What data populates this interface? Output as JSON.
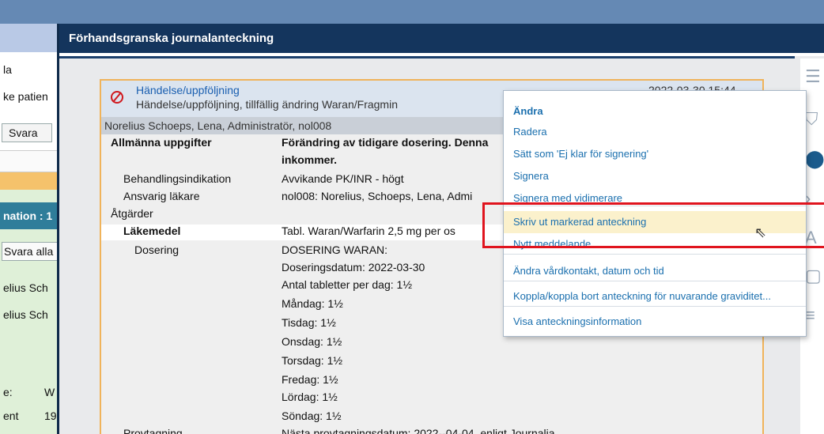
{
  "background": {
    "lines": [
      "la",
      "ke patien"
    ],
    "svara_button": "Svara",
    "info_bar": "nation : 1",
    "svara_alla_button": "Svara alla",
    "list_names": [
      "elius Sch",
      "elius Sch"
    ],
    "field_rows": [
      {
        "label": "e:",
        "value": "W"
      },
      {
        "label": "ent",
        "value": "19"
      }
    ]
  },
  "dialog": {
    "title": "Förhandsgranska journalanteckning"
  },
  "note": {
    "title": "Händelse/uppföljning",
    "subtitle": "Händelse/uppföljning, tillfällig ändring Waran/Fragmin",
    "datetime": "2022-03-30 15:44",
    "author": "Norelius Schoeps, Lena, Administratör, nol008",
    "rows": [
      {
        "label": "Allmänna uppgifter",
        "value": "Förändring av tidigare dosering. Denna",
        "bold": true
      },
      {
        "label": "",
        "value": "inkommer.",
        "bold": true
      },
      {
        "label": "Behandlingsindikation",
        "value": "Avvikande PK/INR - högt"
      },
      {
        "label": "Ansvarig läkare",
        "value": "nol008: Norelius, Schoeps, Lena, Admi"
      },
      {
        "label": "Åtgärder",
        "value": ""
      },
      {
        "label": "Läkemedel",
        "value": "Tabl. Waran/Warfarin 2,5 mg per os"
      },
      {
        "label": "Dosering",
        "value": "DOSERING WARAN:"
      },
      {
        "label": "",
        "value": "Doseringsdatum: 2022-03-30"
      },
      {
        "label": "",
        "value": "Antal tabletter per dag: 1½"
      },
      {
        "label": "",
        "value": "Måndag:  1½"
      },
      {
        "label": "",
        "value": "Tisdag:   1½"
      },
      {
        "label": "",
        "value": "Onsdag:  1½"
      },
      {
        "label": "",
        "value": "Torsdag:  1½"
      },
      {
        "label": "",
        "value": "Fredag:  1½"
      },
      {
        "label": "",
        "value": "Lördag:  1½"
      },
      {
        "label": "",
        "value": "Söndag:  1½"
      },
      {
        "label": "Provtagning",
        "value": "Nästa provtagningsdatum: 2022--04-04, enligt Journalia"
      }
    ]
  },
  "context_menu": {
    "items": [
      {
        "label": "Ändra"
      },
      {
        "label": "Radera"
      },
      {
        "label": "Sätt som 'Ej klar för signering'"
      },
      {
        "label": "Signera"
      },
      {
        "label": "Signera med vidimerare"
      },
      {
        "label": "Skriv ut markerad anteckning"
      },
      {
        "label": "Nytt meddelande"
      },
      {
        "label": "Ändra vårdkontakt, datum och tid"
      },
      {
        "label": "Koppla/koppla bort anteckning för nuvarande graviditet..."
      },
      {
        "label": "Visa anteckningsinformation"
      }
    ]
  },
  "colors": {
    "accent": "#1a6fae",
    "title_bar": "#14355d",
    "highlight_box": "#e0141e",
    "card_border": "#f0b35a"
  }
}
